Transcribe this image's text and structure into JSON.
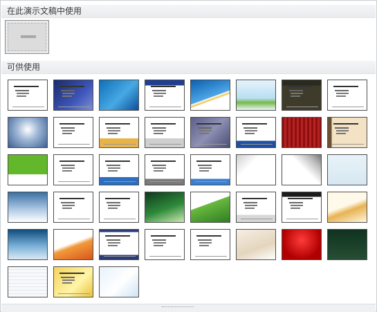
{
  "sections": {
    "current_label": "在此演示文稿中使用",
    "available_label": "可供使用"
  },
  "current_theme": {
    "name": "current-presentation-theme",
    "style": "blank-gray"
  },
  "themes": [
    {
      "style": "plain-white",
      "bg": "#ffffff",
      "text": true
    },
    {
      "style": "blue-dark-lines",
      "bg": "linear-gradient(135deg,#1b2a6b,#3c55b8 60%,#7d8fd4)",
      "text": true
    },
    {
      "style": "blue-water",
      "bg": "linear-gradient(135deg,#0f6fb8,#47a9e4 55%,#0c4f9a)",
      "text": false
    },
    {
      "style": "white-blue-header",
      "bg": "linear-gradient(#1f3f8f 0 18%, #ffffff 18%)",
      "text": true
    },
    {
      "style": "blue-swoosh",
      "bg": "linear-gradient(160deg,#0b5fb0,#4fa7e6 55%,#ffffff 56%,#f2c14a 62%,#ffffff 64%)",
      "text": false
    },
    {
      "style": "sky-buildings",
      "bg": "linear-gradient(#e6f3fb,#b9dff3 60%,#79b84a 75%,#eaf6ff)",
      "text": false
    },
    {
      "style": "dark-olive",
      "bg": "linear-gradient(#2b2a1f 0 18%, #3e3b2b 18%)",
      "text": true
    },
    {
      "style": "white-gray-text",
      "bg": "#ffffff",
      "text": true
    },
    {
      "style": "blue-glow",
      "bg": "radial-gradient(circle at 50% 40%,#ffffff,#9fb7d6 40%,#3c5f92)",
      "text": false
    },
    {
      "style": "white-orange-bullets",
      "bg": "#ffffff",
      "text": true
    },
    {
      "style": "white-gold-bottom",
      "bg": "linear-gradient(#ffffff 70%, #e8b449 70%)",
      "text": true
    },
    {
      "style": "white-gray-bottom",
      "bg": "linear-gradient(#ffffff 70%, #cfcfcf 70%)",
      "text": true
    },
    {
      "style": "purple-gray",
      "bg": "linear-gradient(135deg,#5d5f8a,#8d8fb3 50%,#4b4d75)",
      "text": true
    },
    {
      "style": "blue-corner",
      "bg": "linear-gradient(#ffffff 78%, #1e4fa0 78%)",
      "text": true
    },
    {
      "style": "red-curtain",
      "bg": "repeating-linear-gradient(90deg,#8f0f0f 0 3px,#b52323 3px 6px)",
      "text": false
    },
    {
      "style": "tan-paper",
      "bg": "linear-gradient(90deg,#6b5134 0 10%, #f3e2c3 10%)",
      "text": true
    },
    {
      "style": "green-pie",
      "bg": "linear-gradient(#62b72a 0 65%, #ffffff 65%)",
      "text": false
    },
    {
      "style": "white-teal-left",
      "bg": "#ffffff",
      "text": true
    },
    {
      "style": "white-blue-wave",
      "bg": "linear-gradient(#ffffff 75%, #2c6fc2 75%)",
      "text": true
    },
    {
      "style": "white-gray-bars",
      "bg": "linear-gradient(#ffffff 80%, #7a7a7a 80%)",
      "text": true
    },
    {
      "style": "white-blue-title",
      "bg": "linear-gradient(#ffffff 80%, #3b7fd0 80%)",
      "text": true
    },
    {
      "style": "silver-page-curl",
      "bg": "linear-gradient(135deg,#cfcfcf,#ffffff 35%,#ffffff)",
      "text": false
    },
    {
      "style": "white-flowers",
      "bg": "linear-gradient(45deg,#ffffff 55%,#bdbdbd 80%,#777)",
      "text": false
    },
    {
      "style": "light-blue-pin",
      "bg": "linear-gradient(#e9f3f8,#d6e7f1)",
      "text": false
    },
    {
      "style": "world-map",
      "bg": "linear-gradient(#3a6fa3,#a9c6e3 55%,#ffffff)",
      "text": false
    },
    {
      "style": "white-teal",
      "bg": "#ffffff",
      "text": true
    },
    {
      "style": "white-bullets",
      "bg": "#ffffff",
      "text": true
    },
    {
      "style": "dark-green-wave",
      "bg": "linear-gradient(160deg,#0e3a1c,#2f8a3b 55%,#cde8b2)",
      "text": false
    },
    {
      "style": "green-hill",
      "bg": "linear-gradient(160deg,#ffffff 40%,#6ab93f 41%,#2f7d23)",
      "text": false
    },
    {
      "style": "white-gray-cube",
      "bg": "linear-gradient(#ffffff 75%, #d8d8d8 75%)",
      "text": true
    },
    {
      "style": "black-header",
      "bg": "linear-gradient(#1b1b1b 0 15%, #ffffff 15%)",
      "text": true
    },
    {
      "style": "gold-swoosh",
      "bg": "linear-gradient(160deg,#fff9ea 45%,#e7b352 60%,#fff6e0)",
      "text": false
    },
    {
      "style": "wind-turbines",
      "bg": "linear-gradient(#0f4d7d,#7ab0d8 55%,#dbeaf4)",
      "text": false
    },
    {
      "style": "orange-swoosh",
      "bg": "linear-gradient(160deg,#ffffff 45%,#f29a3c 55%,#d8561a)",
      "text": false
    },
    {
      "style": "white-navy-bottom",
      "bg": "linear-gradient(#2a3b7a 0 8%, #ffffff 8%, #ffffff 85%, #2a3b7a 85%)",
      "text": true
    },
    {
      "style": "white-plain-text",
      "bg": "#ffffff",
      "text": true
    },
    {
      "style": "white-green-emblem",
      "bg": "#ffffff",
      "text": true
    },
    {
      "style": "beige-curve",
      "bg": "linear-gradient(160deg,#f6efe4,#e4d5bd 60%,#ffffff)",
      "text": false
    },
    {
      "style": "red-drapes",
      "bg": "radial-gradient(circle at 50% 35%,#ff3b3b,#b10000 70%)",
      "text": false
    },
    {
      "style": "chalkboard",
      "bg": "linear-gradient(#0f3320,#274e34)",
      "text": false
    },
    {
      "style": "blue-grid-pencil",
      "bg": "repeating-linear-gradient(0deg,#f7f9fb 0 4px,#e3e8ee 4px 5px)",
      "text": false
    },
    {
      "style": "yellow-doc",
      "bg": "linear-gradient(135deg,#f4d35b,#fff4a8 60%,#e9c23a)",
      "text": true
    },
    {
      "style": "blue-growth-arrow",
      "bg": "linear-gradient(135deg,#e7f2fb,#ffffff 55%,#cfe3f4)",
      "text": false
    }
  ]
}
